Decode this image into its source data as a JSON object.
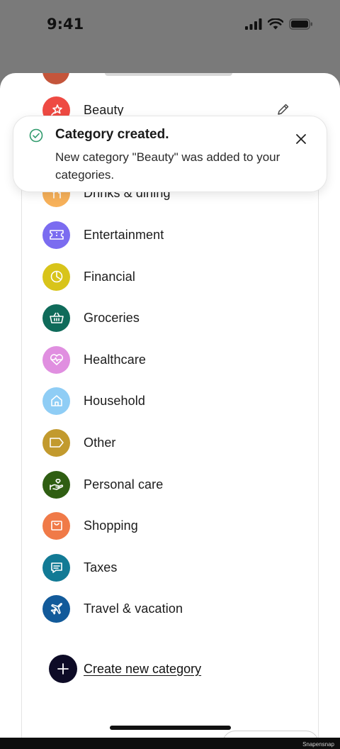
{
  "status_bar": {
    "time": "9:41"
  },
  "categories": [
    {
      "label": "Beauty",
      "icon": "sparkle-star-icon",
      "color": "#ee4a43",
      "show_edit": true
    },
    {
      "label": "Drinks & dining",
      "icon": "fork-knife-icon",
      "color": "#f7b15a"
    },
    {
      "label": "Entertainment",
      "icon": "ticket-icon",
      "color": "#7b6cf0"
    },
    {
      "label": "Financial",
      "icon": "pie-chart-icon",
      "color": "#d8c41a"
    },
    {
      "label": "Groceries",
      "icon": "basket-icon",
      "color": "#0f6b5a"
    },
    {
      "label": "Healthcare",
      "icon": "heartbeat-icon",
      "color": "#e08fe0"
    },
    {
      "label": "Household",
      "icon": "house-icon",
      "color": "#8fcdf5"
    },
    {
      "label": "Other",
      "icon": "tag-icon",
      "color": "#c29a2e"
    },
    {
      "label": "Personal care",
      "icon": "hand-heart-icon",
      "color": "#2f5e12"
    },
    {
      "label": "Shopping",
      "icon": "shopping-bag-icon",
      "color": "#f07a48"
    },
    {
      "label": "Taxes",
      "icon": "receipt-icon",
      "color": "#127a95"
    },
    {
      "label": "Travel & vacation",
      "icon": "airplane-icon",
      "color": "#125a9a"
    }
  ],
  "toast": {
    "title": "Category created.",
    "message": "New category \"Beauty\" was added to your categories.",
    "accent_color": "#2f9a6c"
  },
  "create_button": {
    "label": "Create new category"
  },
  "watermark": "Snapensnap"
}
